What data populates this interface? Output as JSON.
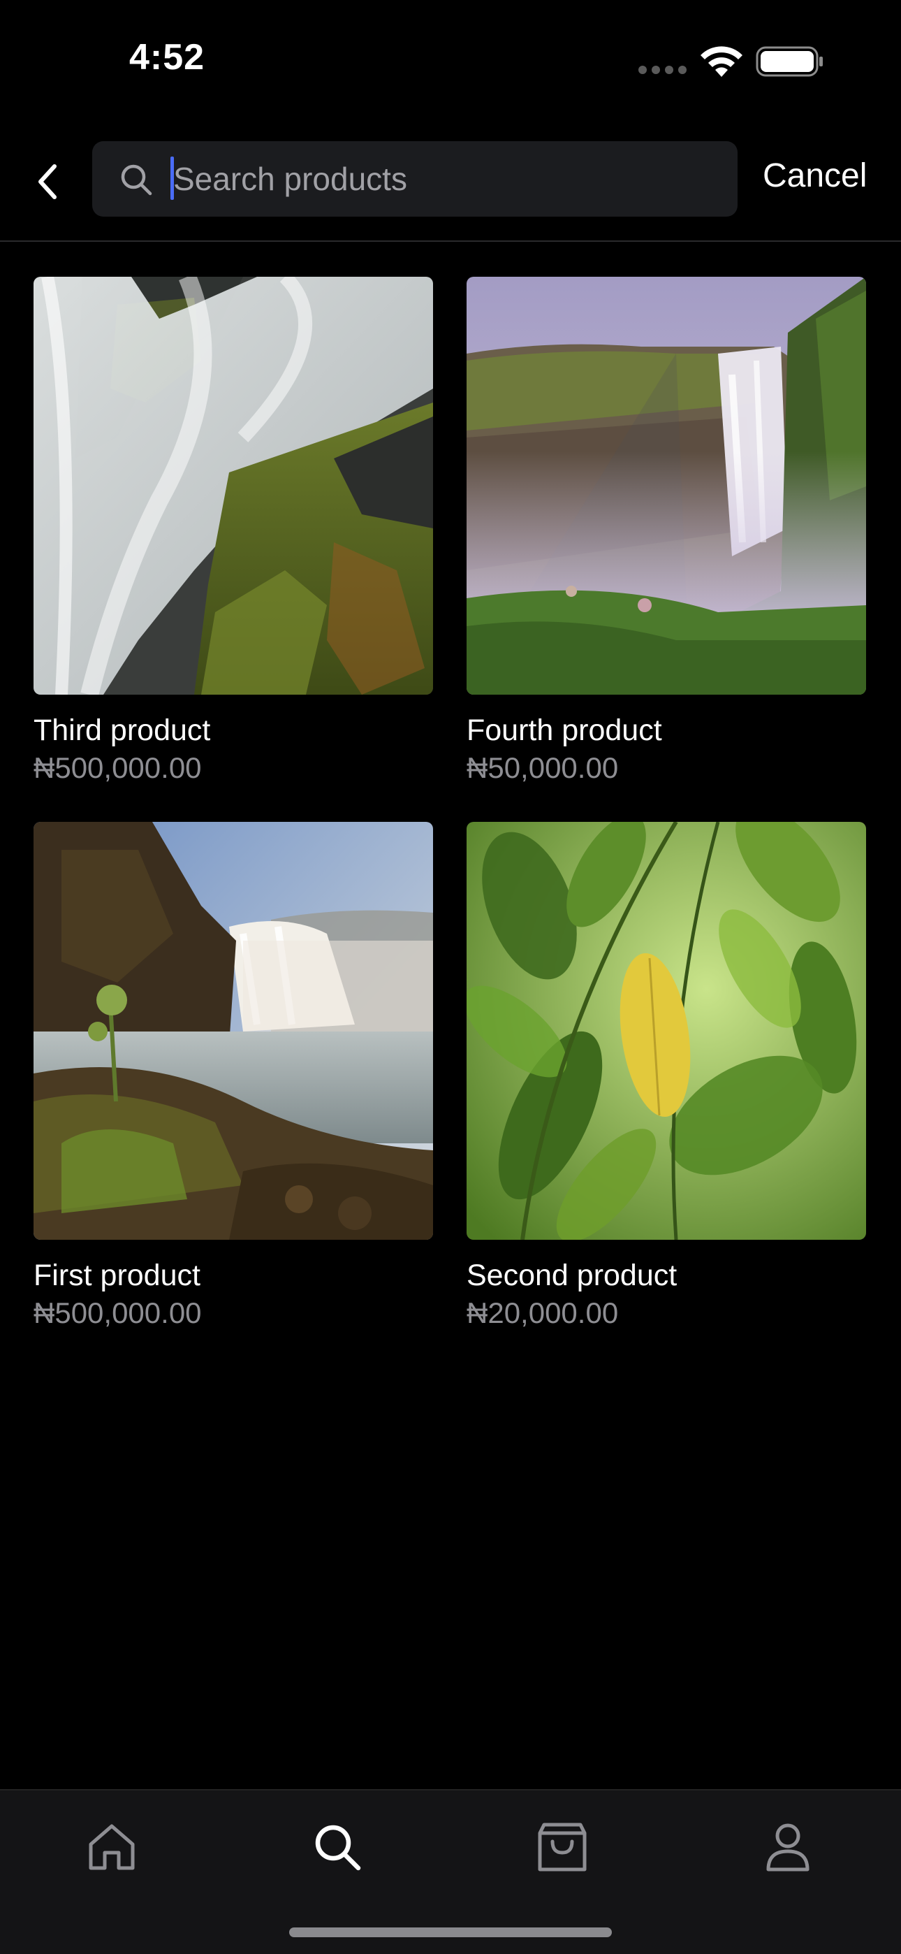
{
  "status_bar": {
    "time": "4:52",
    "icons": [
      "signal-dots-icon",
      "wifi-icon",
      "battery-icon"
    ]
  },
  "header": {
    "back_icon": "chevron-left-icon",
    "search": {
      "icon": "search-icon",
      "value": "",
      "placeholder": "Search products"
    },
    "cancel_label": "Cancel"
  },
  "products": [
    {
      "name": "Third product",
      "price": "₦500,000.00",
      "image": "waterfall-mossy-rocks"
    },
    {
      "name": "Fourth product",
      "price": "₦50,000.00",
      "image": "waterfall-misty-cliff"
    },
    {
      "name": "First product",
      "price": "₦500,000.00",
      "image": "waterfall-rocky-shore"
    },
    {
      "name": "Second product",
      "price": "₦20,000.00",
      "image": "green-leaves"
    }
  ],
  "tabbar": {
    "items": [
      {
        "id": "home",
        "icon": "home-icon",
        "active": false
      },
      {
        "id": "search",
        "icon": "search-icon",
        "active": true
      },
      {
        "id": "cart",
        "icon": "shopping-bag-icon",
        "active": false
      },
      {
        "id": "profile",
        "icon": "user-icon",
        "active": false
      }
    ]
  },
  "colors": {
    "background": "#000000",
    "search_field": "#1b1c1f",
    "caret": "#4a6cf7",
    "price_text": "#8e8e93",
    "tab_inactive": "#8e8e93",
    "tab_active": "#ffffff"
  }
}
